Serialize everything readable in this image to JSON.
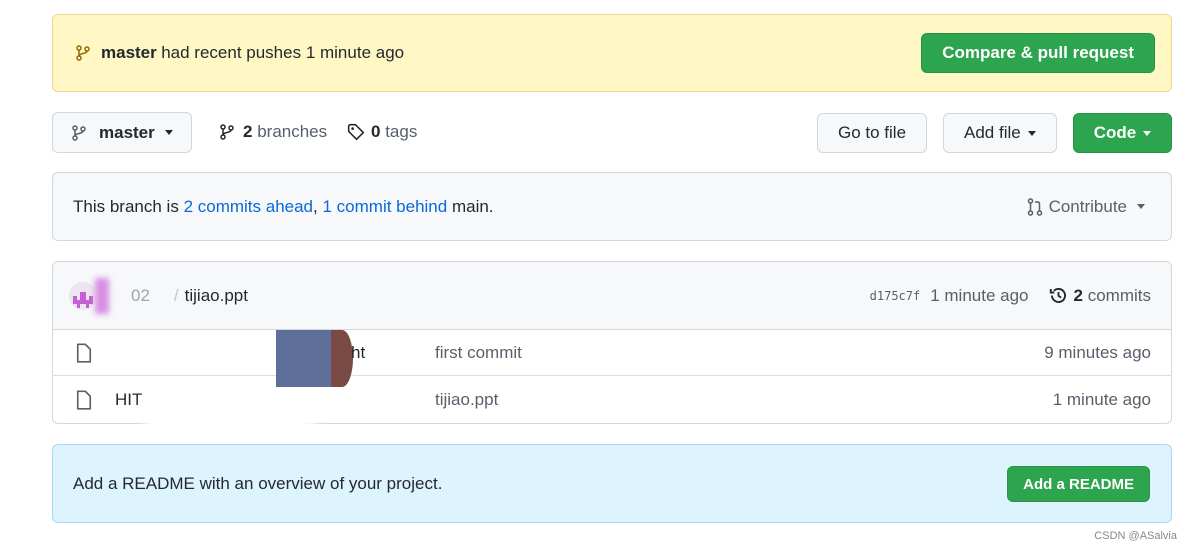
{
  "push_banner": {
    "branch": "master",
    "message": "had recent pushes 1 minute ago",
    "button": "Compare & pull request"
  },
  "toolbar": {
    "branch": "master",
    "branches_count": "2",
    "branches_label": "branches",
    "tags_count": "0",
    "tags_label": "tags",
    "go_to_file": "Go to file",
    "add_file": "Add file",
    "code": "Code"
  },
  "branch_status": {
    "prefix": "This branch is",
    "ahead": "2 commits ahead",
    "sep": ",",
    "behind": "1 commit behind",
    "suffix": "main.",
    "contribute": "Contribute"
  },
  "latest_commit": {
    "message_fragment": "02",
    "slash": "/",
    "message": "tijiao.ppt",
    "sha": "d175c7f",
    "time": "1 minute ago",
    "commits_count": "2",
    "commits_label": "commits"
  },
  "files": [
    {
      "name": "ht",
      "commit": "first commit",
      "time": "9 minutes ago"
    },
    {
      "name": "HIT",
      "commit": "tijiao.ppt",
      "time": "1 minute ago"
    }
  ],
  "readme": {
    "text": "Add a README with an overview of your project.",
    "button": "Add a README"
  },
  "watermark": "CSDN @ASalvia",
  "colors": {
    "accent_green": "#2da44e",
    "link": "#0969da",
    "banner": "#fff8c5",
    "readme_banner": "#ddf4ff"
  }
}
